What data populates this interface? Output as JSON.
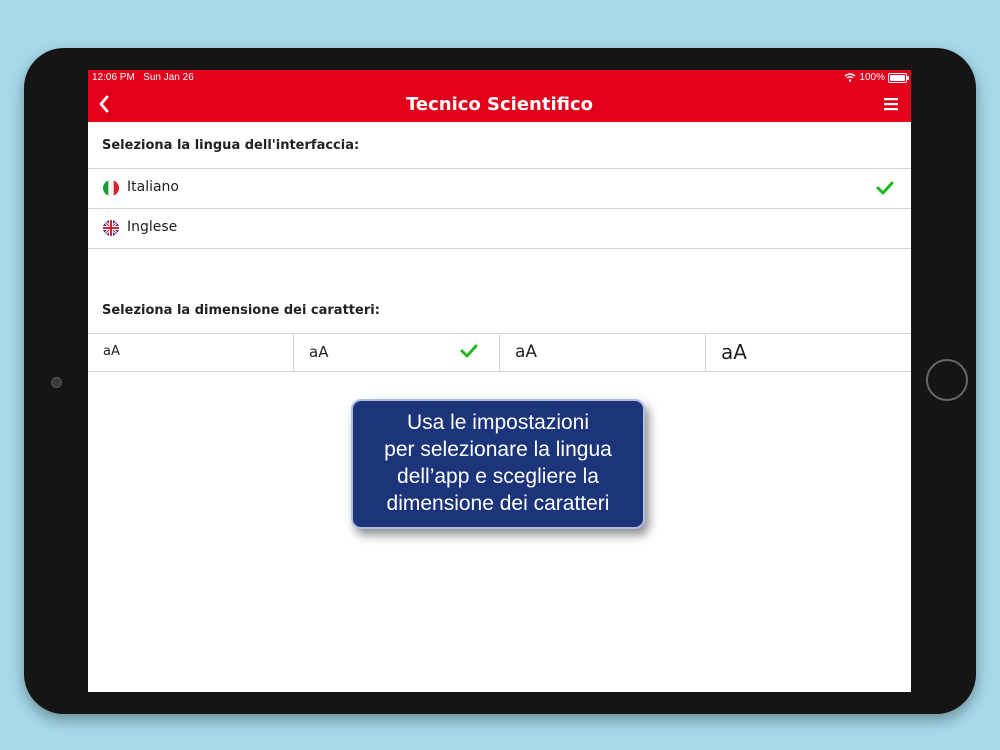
{
  "status": {
    "time": "12:06 PM",
    "date": "Sun Jan 26",
    "battery": "100%"
  },
  "nav": {
    "title": "Tecnico Scientifico",
    "back_icon": "chevron-left-icon",
    "menu_icon": "hamburger-menu-icon"
  },
  "language_section": {
    "label": "Seleziona la lingua dell'interfaccia:",
    "options": [
      {
        "label": "Italiano",
        "flag": "italy-flag-icon",
        "selected": true
      },
      {
        "label": "Inglese",
        "flag": "uk-flag-icon",
        "selected": false
      }
    ]
  },
  "font_size_section": {
    "label": "Seleziona la dimensione dei caratteri:",
    "options": [
      {
        "label": "aA",
        "selected": false
      },
      {
        "label": "aA",
        "selected": true
      },
      {
        "label": "aA",
        "selected": false
      },
      {
        "label": "aA",
        "selected": false
      }
    ]
  },
  "tooltip": {
    "lines": [
      "Usa le impostazioni",
      "per selezionare la lingua",
      "dell’app e scegliere la",
      "dimensione dei caratteri"
    ]
  },
  "colors": {
    "accent": "#e2001a",
    "check": "#1fb81f",
    "tooltip_bg": "#1c347a",
    "background": "#a6d9ea"
  }
}
